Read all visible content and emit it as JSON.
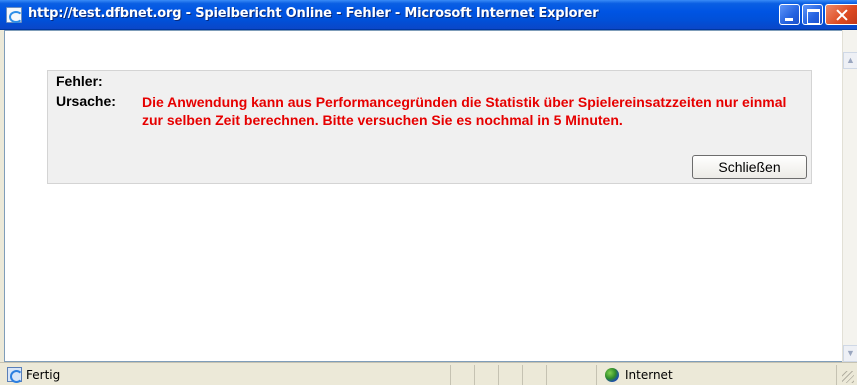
{
  "window": {
    "title": "http://test.dfbnet.org - Spielbericht Online - Fehler - Microsoft Internet Explorer"
  },
  "error": {
    "fehler_label": "Fehler:",
    "ursache_label": "Ursache:",
    "message": "Die Anwendung kann aus Performancegründen die Statistik über Spielereinsatzzeiten nur einmal zur selben Zeit berechnen. Bitte versuchen Sie es nochmal in 5 Minuten.",
    "close_button_label": "Schließen"
  },
  "statusbar": {
    "status_text": "Fertig",
    "zone_text": "Internet"
  },
  "colors": {
    "message": "#e60000",
    "titlebar": "#0054e3",
    "box_background": "#f0f0f0"
  }
}
